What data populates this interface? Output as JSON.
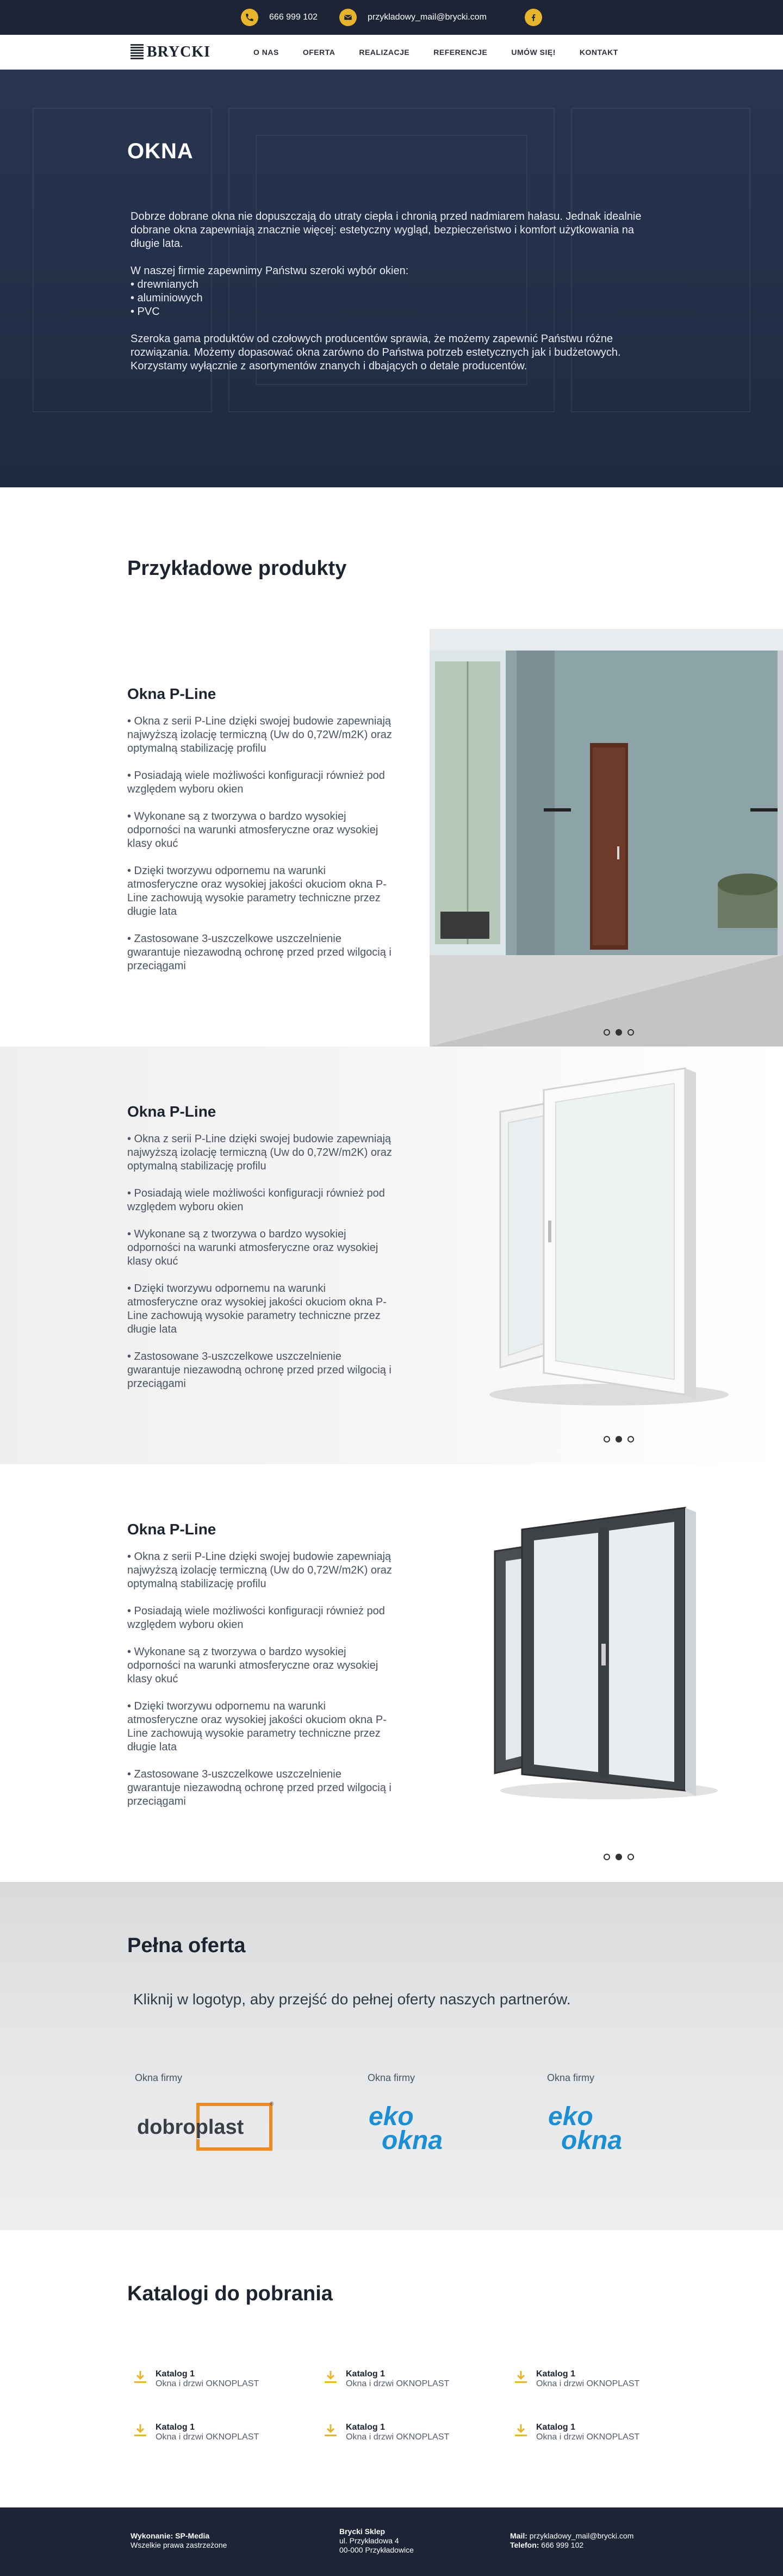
{
  "topbar": {
    "phone": "666 999 102",
    "email": "przykladowy_mail@brycki.com",
    "phone_icon": "phone-icon",
    "email_icon": "mail-icon",
    "facebook_icon": "facebook-icon"
  },
  "nav": {
    "logo_text": "BRYCKI",
    "items": [
      "O NAS",
      "OFERTA",
      "REALIZACJE",
      "REFERENCJE",
      "UMÓW SIĘ!",
      "KONTAKT"
    ]
  },
  "hero": {
    "title": "OKNA",
    "para1": "Dobrze dobrane okna nie dopuszczają do utraty ciepła i chronią przed nadmiarem hałasu. Jednak idealnie dobrane okna zapewniają znacznie więcej: estetyczny wygląd, bezpieczeństwo i komfort użytkowania na długie lata.",
    "list_intro": "W naszej firmie zapewnimy Państwu szeroki wybór okien:",
    "types": [
      "• drewnianych",
      "• aluminiowych",
      "• PVC"
    ],
    "para2": "Szeroka gama produktów od czołowych producentów sprawia, że możemy zapewnić Państwu różne rozwiązania. Możemy dopasować okna zarówno do Państwa potrzeb estetycznych jak i budżetowych. Korzystamy wyłącznie z asortymentów znanych i dbających o detale producentów."
  },
  "products_title": "Przykładowe produkty",
  "products": [
    {
      "title": "Okna P-Line",
      "bullets": [
        "• Okna z serii P-Line dzięki swojej budowie zapewniają najwyższą izolację termiczną (Uw do 0,72W/m2K) oraz optymalną stabilizację profilu",
        "• Posiadają wiele możliwości konfiguracji również pod względem wyboru okien",
        "• Wykonane są z tworzywa o bardzo wysokiej odporności na warunki atmosferyczne oraz wysokiej klasy okuć",
        "• Dzięki tworzywu odpornemu na warunki atmosferyczne oraz wysokiej jakości okuciom okna P-Line zachowują wysokie parametry techniczne przez długie lata",
        "• Zastosowane 3-uszczelkowe uszczelnienie gwarantuje niezawodną ochronę przed przed wilgocią i przeciągami"
      ]
    },
    {
      "title": "Okna P-Line",
      "bullets": [
        "• Okna z serii P-Line dzięki swojej budowie zapewniają najwyższą izolację termiczną (Uw do 0,72W/m2K) oraz optymalną stabilizację profilu",
        "• Posiadają wiele możliwości konfiguracji również pod względem wyboru okien",
        "• Wykonane są z tworzywa o bardzo wysokiej odporności na warunki atmosferyczne oraz wysokiej klasy okuć",
        "• Dzięki tworzywu odpornemu na warunki atmosferyczne oraz wysokiej jakości okuciom okna P-Line zachowują wysokie parametry techniczne przez długie lata",
        "• Zastosowane 3-uszczelkowe uszczelnienie gwarantuje niezawodną ochronę przed przed wilgocią i przeciągami"
      ]
    },
    {
      "title": "Okna P-Line",
      "bullets": [
        "• Okna z serii P-Line dzięki swojej budowie zapewniają najwyższą izolację termiczną (Uw do 0,72W/m2K) oraz optymalną stabilizację profilu",
        "• Posiadają wiele możliwości konfiguracji również pod względem wyboru okien",
        "• Wykonane są z tworzywa o bardzo wysokiej odporności na warunki atmosferyczne oraz wysokiej klasy okuć",
        "• Dzięki tworzywu odpornemu na warunki atmosferyczne oraz wysokiej jakości okuciom okna P-Line zachowują wysokie parametry techniczne przez długie lata",
        "• Zastosowane 3-uszczelkowe uszczelnienie gwarantuje niezawodną ochronę przed przed wilgocią i przeciągami"
      ]
    }
  ],
  "offer": {
    "title": "Pełna oferta",
    "lead": "Kliknij w logotyp, aby przejść do pełnej oferty naszych partnerów.",
    "partners": [
      {
        "label": "Okna firmy",
        "logo": "dobroplast"
      },
      {
        "label": "Okna firmy",
        "logo": "ekookna"
      },
      {
        "label": "Okna firmy",
        "logo": "ekookna"
      }
    ]
  },
  "catalogs": {
    "title": "Katalogi do pobrania",
    "items": [
      {
        "title": "Katalog 1",
        "subtitle": "Okna i drzwi OKNOPLAST"
      },
      {
        "title": "Katalog 1",
        "subtitle": "Okna i drzwi OKNOPLAST"
      },
      {
        "title": "Katalog 1",
        "subtitle": "Okna i drzwi OKNOPLAST"
      },
      {
        "title": "Katalog 1",
        "subtitle": "Okna i drzwi OKNOPLAST"
      },
      {
        "title": "Katalog 1",
        "subtitle": "Okna i drzwi OKNOPLAST"
      },
      {
        "title": "Katalog 1",
        "subtitle": "Okna i drzwi OKNOPLAST"
      }
    ]
  },
  "footer": {
    "credit_label": "Wykonanie:",
    "credit_value": "SP-Media",
    "rights": "Wszelkie prawa zastrzeżone",
    "company": "Brycki Sklep",
    "street": "ul. Przykładowa 4",
    "city": "00-000 Przykładowice",
    "mail_label": "Mail:",
    "mail": "przykladowy_mail@brycki.com",
    "phone_label": "Telefon:",
    "phone": "666 999 102"
  },
  "colors": {
    "navy": "#1c2436",
    "accent": "#e7b52c",
    "eko_blue": "#1a8fd6",
    "dobroplast_orange": "#f08a1c"
  }
}
